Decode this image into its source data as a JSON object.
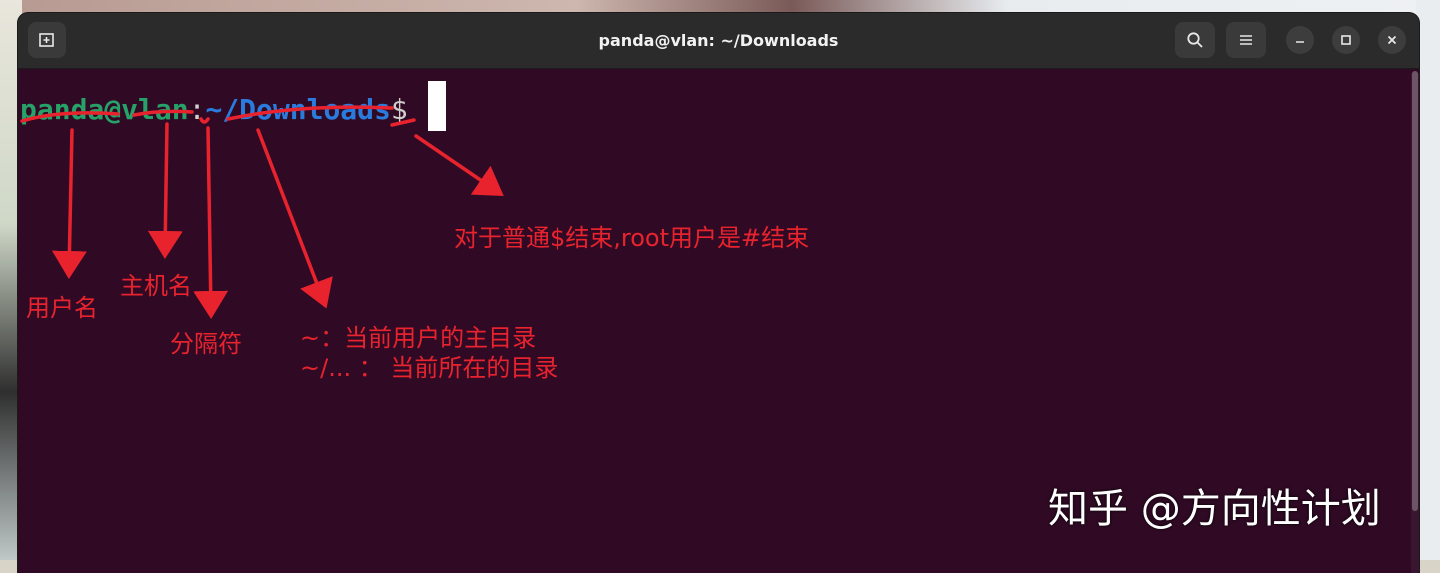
{
  "window": {
    "title": "panda@vlan: ~/Downloads"
  },
  "titlebar": {
    "new_tab_icon": "new-tab-icon",
    "search_icon": "search-icon",
    "menu_icon": "hamburger-menu-icon",
    "minimize_icon": "minimize-icon",
    "maximize_icon": "maximize-icon",
    "close_icon": "close-icon"
  },
  "terminal": {
    "prompt_user_host": "panda@vlan",
    "prompt_separator": ":",
    "prompt_path": "~/Downloads",
    "prompt_symbol": "$",
    "colors": {
      "background": "#300a24",
      "user_host": "#26a269",
      "path": "#2a7bde",
      "text": "#d0cfcc"
    }
  },
  "annotations": {
    "color": "#e8232e",
    "username_label": "用户名",
    "hostname_label": "主机名",
    "separator_label": "分隔符",
    "path_label_line1": "~：当前用户的主目录",
    "path_label_line2": "~/... ： 当前所在的目录",
    "prompt_end_label": "对于普通$结束,root用户是#结束"
  },
  "watermark": {
    "text": "知乎 @方向性计划"
  }
}
